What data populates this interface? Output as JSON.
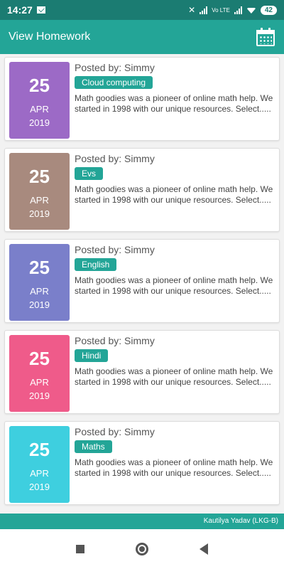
{
  "status_bar": {
    "time": "14:27",
    "battery": "42",
    "network_label": "Vo LTE"
  },
  "app_bar": {
    "title": "View Homework",
    "calendar_icon": "calendar-icon"
  },
  "homework": [
    {
      "day": "25",
      "month": "APR",
      "year": "2019",
      "posted_by": "Posted by: Simmy",
      "subject": "Cloud computing",
      "description": "Math goodies was a pioneer of online math help. We started in 1998 with our unique resources. Select.....",
      "color": "#9c6ac6"
    },
    {
      "day": "25",
      "month": "APR",
      "year": "2019",
      "posted_by": "Posted by: Simmy",
      "subject": "Evs",
      "description": "Math goodies was a pioneer of online math help. We started in 1998 with our unique resources. Select.....",
      "color": "#a88a7e"
    },
    {
      "day": "25",
      "month": "APR",
      "year": "2019",
      "posted_by": "Posted by: Simmy",
      "subject": "English",
      "description": "Math goodies was a pioneer of online math help. We started in 1998 with our unique resources. Select.....",
      "color": "#7a7fca"
    },
    {
      "day": "25",
      "month": "APR",
      "year": "2019",
      "posted_by": "Posted by: Simmy",
      "subject": "Hindi",
      "description": "Math goodies was a pioneer of online math help. We started in 1998 with our unique resources. Select.....",
      "color": "#ef5b8a"
    },
    {
      "day": "25",
      "month": "APR",
      "year": "2019",
      "posted_by": "Posted by: Simmy",
      "subject": "Maths",
      "description": "Math goodies was a pioneer of online math help. We started in 1998 with our unique resources. Select.....",
      "color": "#3ecfdf"
    }
  ],
  "footer": {
    "student": "Kautilya Yadav (LKG-B)"
  },
  "colors": {
    "status_bar": "#1b7c72",
    "app_bar": "#23a597",
    "tag": "#23a597"
  }
}
